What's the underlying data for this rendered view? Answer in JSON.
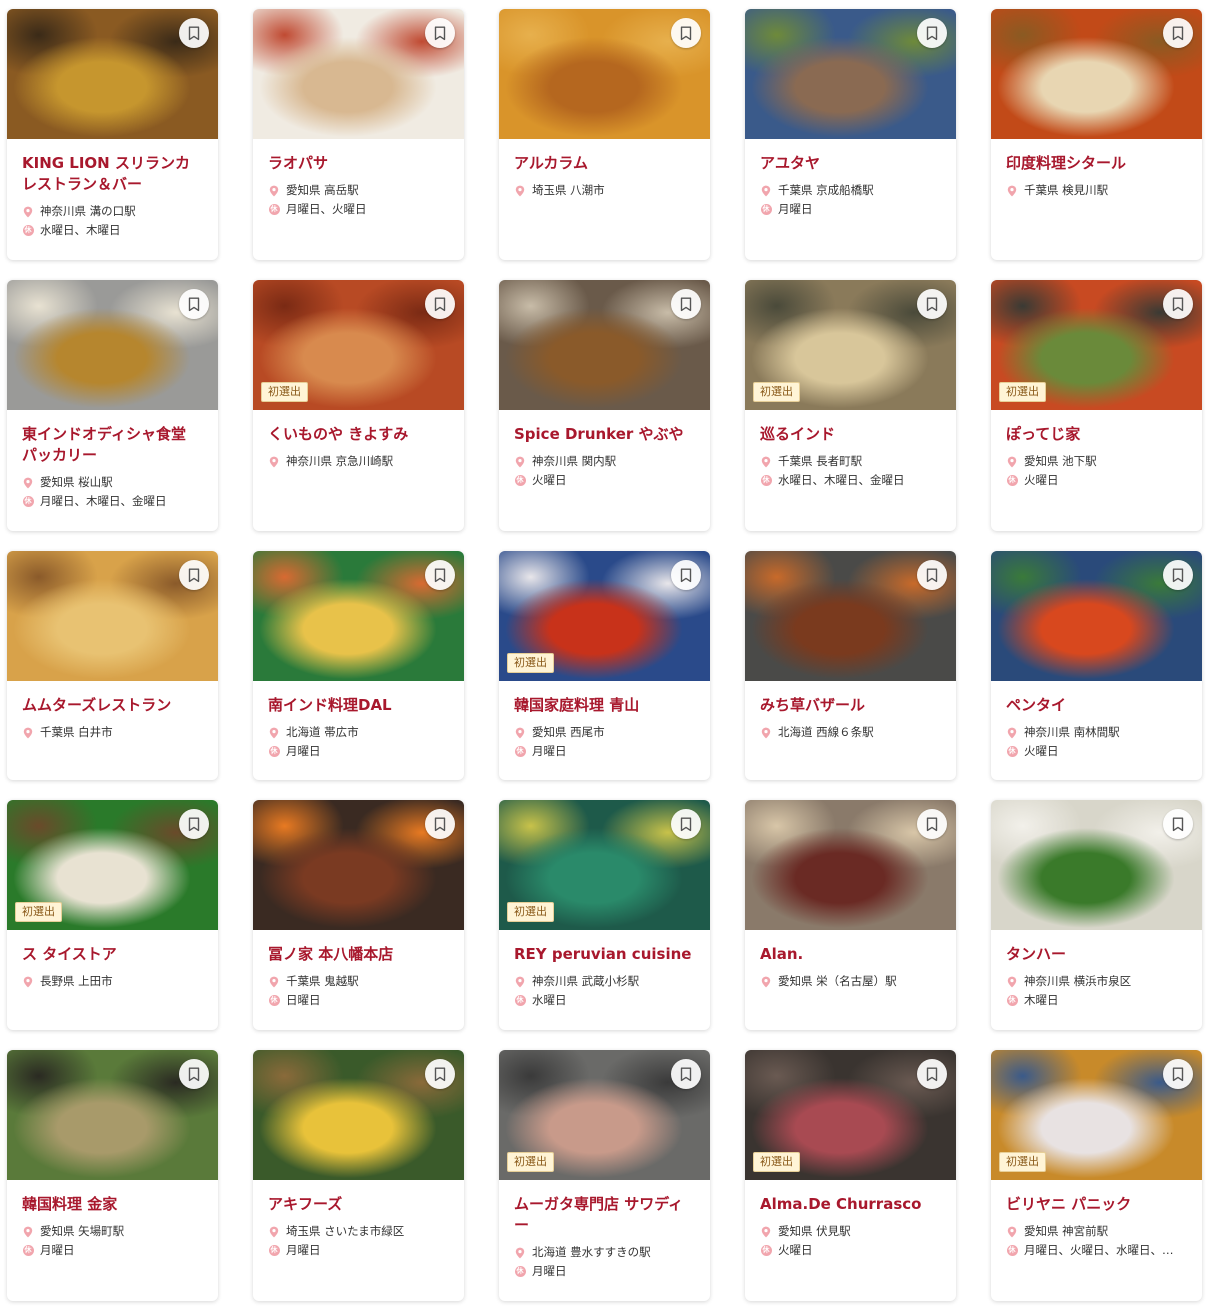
{
  "badge_label": "初選出",
  "holiday_glyph": "休",
  "colors": {
    "name": "#a8182d",
    "pin": "#f1a5ad",
    "badge_bg": "#fff4d6"
  },
  "restaurants": [
    {
      "name": "KING LION スリランカレストラン＆バー",
      "location": "神奈川県 溝の口駅",
      "holiday": "水曜日、木曜日",
      "new": false,
      "photo": [
        "#8a5a22",
        "#c6962e",
        "#3a2a18"
      ]
    },
    {
      "name": "ラオパサ",
      "location": "愛知県 高岳駅",
      "holiday": "月曜日、火曜日",
      "new": false,
      "photo": [
        "#f0ebe2",
        "#d8b891",
        "#c04a32"
      ]
    },
    {
      "name": "アルカラム",
      "location": "埼玉県 八潮市",
      "holiday": "",
      "new": false,
      "photo": [
        "#d9942a",
        "#b5671f",
        "#e7b04d"
      ]
    },
    {
      "name": "アユタヤ",
      "location": "千葉県 京成船橋駅",
      "holiday": "月曜日",
      "new": false,
      "photo": [
        "#3a5a8a",
        "#8a6a52",
        "#6e8a3a"
      ]
    },
    {
      "name": "印度料理シタール",
      "location": "千葉県 検見川駅",
      "holiday": "",
      "new": false,
      "photo": [
        "#c24a18",
        "#e8d6b2",
        "#8a5a22"
      ]
    },
    {
      "name": "東インドオディシャ食堂 パッカリー",
      "location": "愛知県 桜山駅",
      "holiday": "月曜日、木曜日、金曜日",
      "new": false,
      "photo": [
        "#9a9a98",
        "#b6862e",
        "#e8e2d2"
      ]
    },
    {
      "name": "くいものや きよすみ",
      "location": "神奈川県 京急川崎駅",
      "holiday": "",
      "new": true,
      "photo": [
        "#b84a24",
        "#d88a4e",
        "#7a2a14"
      ]
    },
    {
      "name": "Spice Drunker やぶや",
      "location": "神奈川県 関内駅",
      "holiday": "火曜日",
      "new": false,
      "photo": [
        "#6a5a4a",
        "#8a5a2a",
        "#c8bca8"
      ]
    },
    {
      "name": "巡るインド",
      "location": "千葉県 長者町駅",
      "holiday": "水曜日、木曜日、金曜日",
      "new": true,
      "photo": [
        "#8a7a5a",
        "#d8c69a",
        "#4a4a3a"
      ]
    },
    {
      "name": "ぽってじ家",
      "location": "愛知県 池下駅",
      "holiday": "火曜日",
      "new": true,
      "photo": [
        "#c84a22",
        "#6a8a3a",
        "#3a3a34"
      ]
    },
    {
      "name": "ムムターズレストラン",
      "location": "千葉県 白井市",
      "holiday": "",
      "new": false,
      "photo": [
        "#d8a24a",
        "#e8c272",
        "#8a5a2a"
      ]
    },
    {
      "name": "南インド料理DAL",
      "location": "北海道 帯広市",
      "holiday": "月曜日",
      "new": false,
      "photo": [
        "#2a7a3a",
        "#e8c24a",
        "#d86a32"
      ]
    },
    {
      "name": "韓国家庭料理 青山",
      "location": "愛知県 西尾市",
      "holiday": "月曜日",
      "new": true,
      "photo": [
        "#2a4a8a",
        "#c8321a",
        "#e8e6ea"
      ]
    },
    {
      "name": "みち草バザール",
      "location": "北海道 西線６条駅",
      "holiday": "",
      "new": false,
      "photo": [
        "#4a4a48",
        "#7a3a1e",
        "#c86a2a"
      ]
    },
    {
      "name": "ペンタイ",
      "location": "神奈川県 南林間駅",
      "holiday": "火曜日",
      "new": false,
      "photo": [
        "#2a4a7a",
        "#d8481e",
        "#3a7a3a"
      ]
    },
    {
      "name": "ス タイストア",
      "location": "長野県 上田市",
      "holiday": "",
      "new": true,
      "photo": [
        "#2a7a2a",
        "#e8e2d2",
        "#6a4a2a"
      ]
    },
    {
      "name": "冨ノ家 本八幡本店",
      "location": "千葉県 鬼越駅",
      "holiday": "日曜日",
      "new": false,
      "photo": [
        "#3a2a22",
        "#7a3a22",
        "#e87a22"
      ]
    },
    {
      "name": "REY peruvian cuisine",
      "location": "神奈川県 武蔵小杉駅",
      "holiday": "水曜日",
      "new": true,
      "photo": [
        "#1e5a4a",
        "#2a8a6a",
        "#c8c24a"
      ]
    },
    {
      "name": "Alan.",
      "location": "愛知県 栄（名古屋）駅",
      "holiday": "",
      "new": false,
      "photo": [
        "#8a7a6a",
        "#6a2a24",
        "#d8c6a8"
      ]
    },
    {
      "name": "タンハー",
      "location": "神奈川県 横浜市泉区",
      "holiday": "木曜日",
      "new": false,
      "photo": [
        "#d8d6ca",
        "#3a7a2a",
        "#f2f0ea"
      ]
    },
    {
      "name": "韓国料理 金家",
      "location": "愛知県 矢場町駅",
      "holiday": "月曜日",
      "new": false,
      "photo": [
        "#5a7a3a",
        "#a89a6a",
        "#2a2a22"
      ]
    },
    {
      "name": "アキフーズ",
      "location": "埼玉県 さいたま市緑区",
      "holiday": "月曜日",
      "new": false,
      "photo": [
        "#3a5a2a",
        "#e8c23a",
        "#8a6a3a"
      ]
    },
    {
      "name": "ムーガタ専門店 サワディー",
      "location": "北海道 豊水すすきの駅",
      "holiday": "月曜日",
      "new": true,
      "photo": [
        "#6a6a68",
        "#c89a8a",
        "#3a3a3a"
      ]
    },
    {
      "name": "Alma.De Churrasco",
      "location": "愛知県 伏見駅",
      "holiday": "火曜日",
      "new": true,
      "photo": [
        "#3a3430",
        "#a84a52",
        "#6a5a52"
      ]
    },
    {
      "name": "ビリヤニ パニック",
      "location": "愛知県 神宮前駅",
      "holiday": "月曜日、火曜日、水曜日、…",
      "new": true,
      "photo": [
        "#c88a2a",
        "#e8e2e2",
        "#3a5a8a"
      ]
    }
  ]
}
